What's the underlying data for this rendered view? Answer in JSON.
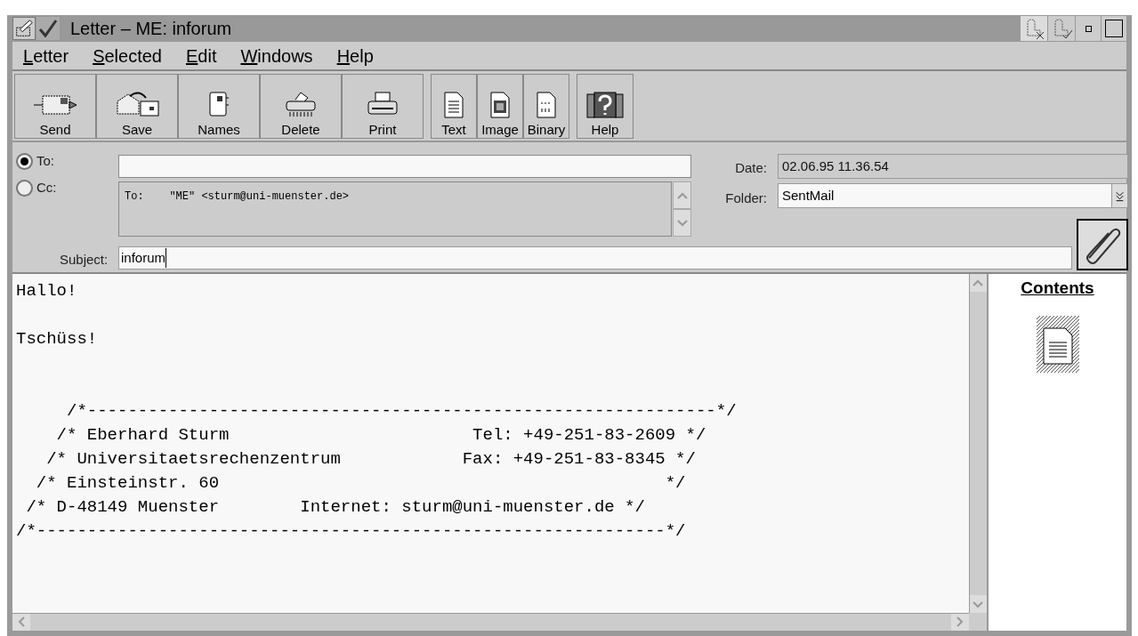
{
  "window": {
    "title": "Letter – ME: inforum"
  },
  "menu": [
    "Letter",
    "Selected",
    "Edit",
    "Windows",
    "Help"
  ],
  "toolbar": [
    [
      {
        "label": "Send",
        "kind": "send"
      },
      {
        "label": "Save",
        "kind": "save"
      },
      {
        "label": "Names",
        "kind": "names"
      },
      {
        "label": "Delete",
        "kind": "delete"
      },
      {
        "label": "Print",
        "kind": "print"
      }
    ],
    [
      {
        "label": "Text",
        "kind": "text"
      },
      {
        "label": "Image",
        "kind": "image"
      },
      {
        "label": "Binary",
        "kind": "binary"
      }
    ],
    [
      {
        "label": "Help",
        "kind": "help"
      }
    ]
  ],
  "recipient_modes": [
    {
      "label": "To:",
      "selected": true
    },
    {
      "label": "Cc:",
      "selected": false
    }
  ],
  "recipients_list": "To:    \"ME\" <sturm@uni-muenster.de>",
  "date": {
    "label": "Date:",
    "value": "02.06.95 11.36.54"
  },
  "folder": {
    "label": "Folder:",
    "value": "SentMail"
  },
  "subject": {
    "label": "Subject:",
    "value": "inforum"
  },
  "body": "Hallo!\n\nTschüss!\n\n\n     /*--------------------------------------------------------------*/\n    /* Eberhard Sturm                        Tel: +49-251-83-2609 */\n   /* Universitaetsrechenzentrum            Fax: +49-251-83-8345 */\n  /* Einsteinstr. 60                                            */\n /* D-48149 Muenster        Internet: sturm@uni-muenster.de */\n/*--------------------------------------------------------------*/",
  "contents": {
    "title": "Contents"
  }
}
